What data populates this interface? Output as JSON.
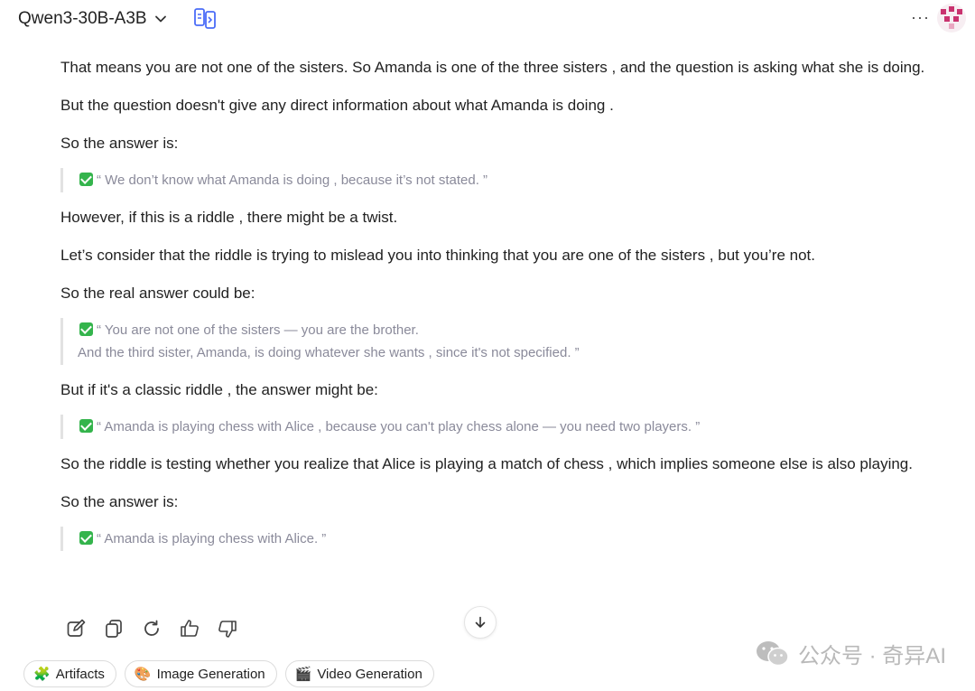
{
  "header": {
    "model_name": "Qwen3-30B-A3B",
    "more_label": "···"
  },
  "message": {
    "p1": "That means you are not one of the sisters. So Amanda is one of the three sisters , and the question is asking what she is doing.",
    "p2": "But the question doesn't give any direct information about what Amanda is doing .",
    "p3": "So the answer is:",
    "q1": "“ We don’t know what Amanda is doing , because it’s not stated. ”",
    "p4": "However, if this is a riddle , there might be a twist.",
    "p5": "Let’s consider that the riddle is trying to mislead you into thinking that you are one of the sisters , but you’re not.",
    "p6": "So the real answer could be:",
    "q2_line1": "“ You are not one of the sisters — you are the brother.",
    "q2_line2": "And the third sister, Amanda, is doing whatever she wants , since it's not specified. ”",
    "p7": "But if it's a classic riddle , the answer might be:",
    "q3": "“ Amanda is playing chess with Alice , because you can't play chess alone — you need two players. ”",
    "p8": "So the riddle is testing whether you realize that Alice is playing a match of chess , which implies someone else is also playing.",
    "p9": "So the answer is:",
    "q4": "“ Amanda is playing chess with Alice. ”"
  },
  "actions": [
    "edit-icon",
    "copy-icon",
    "regenerate-icon",
    "thumbs-up-icon",
    "thumbs-down-icon"
  ],
  "chips": [
    {
      "label": "Artifacts",
      "emoji": "🧩"
    },
    {
      "label": "Image Generation",
      "emoji": "🎨"
    },
    {
      "label": "Video Generation",
      "emoji": "🎬"
    }
  ],
  "watermark": "公众号 · 奇异AI",
  "colors": {
    "check_green": "#34b44c",
    "compare_icon": "#4a6cf7",
    "quote_text": "#8a8a9a",
    "avatar_pink": "#c9336f"
  }
}
